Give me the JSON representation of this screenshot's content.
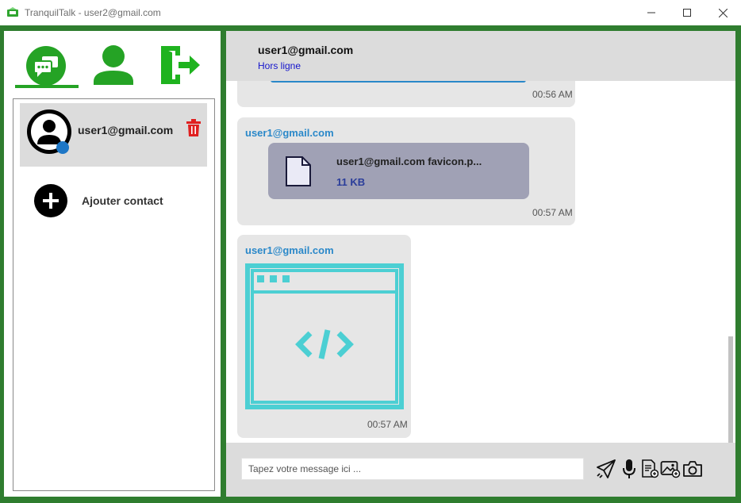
{
  "window": {
    "title": "TranquilTalk - user2@gmail.com",
    "controls": [
      "minimize-icon",
      "maximize-icon",
      "close-icon"
    ]
  },
  "colors": {
    "frame": "#2f7d2f",
    "nav_green": "#25a325",
    "exit_green": "#1fb31f",
    "sender_blue": "#2a88c9",
    "status_blue": "#1515cc",
    "trash_red": "#e02020",
    "file_card": "#a0a1b5",
    "image_teal": "#4ccfd3"
  },
  "nav": {
    "items": [
      {
        "icon": "chat-icon",
        "active": true
      },
      {
        "icon": "profile-icon",
        "active": false
      },
      {
        "icon": "logout-icon",
        "active": false
      }
    ]
  },
  "contacts": {
    "items": [
      {
        "name": "user1@gmail.com",
        "icon": "avatar-icon",
        "delete_icon": "trash-icon"
      }
    ],
    "add_label": "Ajouter contact"
  },
  "chat": {
    "contact_name": "user1@gmail.com",
    "status": "Hors ligne",
    "messages": [
      {
        "kind": "partial",
        "time": "00:56 AM"
      },
      {
        "kind": "file",
        "sender": "user1@gmail.com",
        "file_name": "user1@gmail.com favicon.p...",
        "file_size": "11 KB",
        "time": "00:57 AM"
      },
      {
        "kind": "image",
        "sender": "user1@gmail.com",
        "image_icon": "code-window-icon",
        "time": "00:57 AM"
      }
    ]
  },
  "composer": {
    "placeholder": "Tapez votre message ici ...",
    "value": "",
    "tools": [
      "send-icon",
      "microphone-icon",
      "document-icon",
      "image-icon",
      "camera-icon"
    ]
  }
}
